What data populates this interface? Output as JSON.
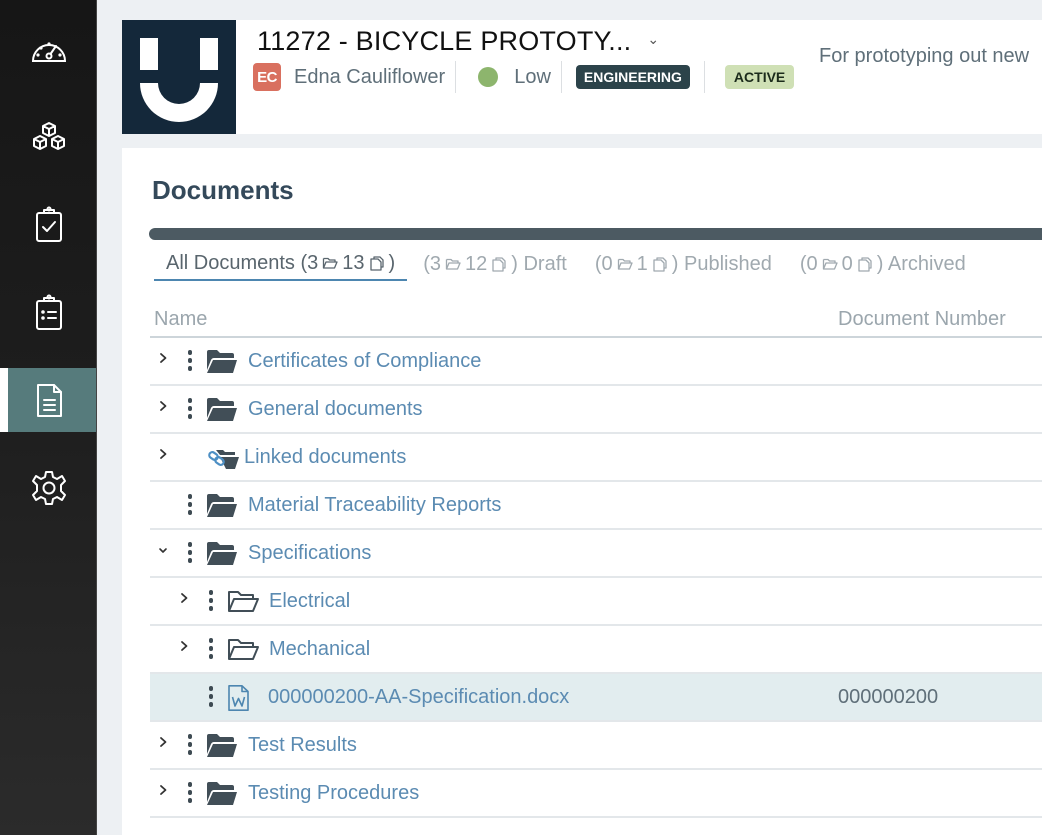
{
  "sidebar": {
    "items": [
      {
        "name": "dashboard",
        "icon": "gauge-icon",
        "active": false
      },
      {
        "name": "inventory",
        "icon": "cubes-icon",
        "active": false
      },
      {
        "name": "tasks",
        "icon": "clipboard-check-icon",
        "active": false
      },
      {
        "name": "lists",
        "icon": "clipboard-list-icon",
        "active": false
      },
      {
        "name": "documents",
        "icon": "document-icon",
        "active": true
      },
      {
        "name": "settings",
        "icon": "gear-icon",
        "active": false
      }
    ]
  },
  "header": {
    "title": "11272 - BICYCLE PROTOTY...",
    "owner_initials": "EC",
    "owner_name": "Edna Cauliflower",
    "priority": "Low",
    "department_badge": "ENGINEERING",
    "status_badge": "ACTIVE",
    "description": "For prototyping out new",
    "colors": {
      "logo_bg": "#14283a",
      "avatar": "#d9705f",
      "priority_dot": "#8db56d",
      "engineering_badge": "#2c434a",
      "active_badge": "#cfe0b5"
    }
  },
  "documents": {
    "title": "Documents",
    "tabs": [
      {
        "prefix": "All Documents (",
        "folders": "3",
        "files": "13",
        "suffix": ")",
        "label_after": "",
        "active": true
      },
      {
        "prefix": "(",
        "folders": "3",
        "files": "12",
        "suffix": ")",
        "label_after": " Draft",
        "active": false
      },
      {
        "prefix": "(",
        "folders": "0",
        "files": "1",
        "suffix": ")",
        "label_after": " Published",
        "active": false
      },
      {
        "prefix": "(",
        "folders": "0",
        "files": "0",
        "suffix": ")",
        "label_after": " Archived",
        "active": false
      }
    ],
    "columns": {
      "name": "Name",
      "document_number": "Document Number"
    },
    "rows": [
      {
        "name": "Certificates of Compliance",
        "type": "folder",
        "level": 0,
        "expander": "collapsed",
        "menu": true,
        "doc_number": ""
      },
      {
        "name": "General documents",
        "type": "folder",
        "level": 0,
        "expander": "collapsed",
        "menu": true,
        "doc_number": ""
      },
      {
        "name": "Linked documents",
        "type": "linked-folder",
        "level": 0,
        "expander": "collapsed",
        "menu": false,
        "doc_number": ""
      },
      {
        "name": "Material Traceability Reports",
        "type": "folder",
        "level": 0,
        "expander": "none",
        "menu": true,
        "doc_number": ""
      },
      {
        "name": "Specifications",
        "type": "folder",
        "level": 0,
        "expander": "expanded",
        "menu": true,
        "doc_number": ""
      },
      {
        "name": "Electrical",
        "type": "folder-outline",
        "level": 1,
        "expander": "collapsed",
        "menu": true,
        "doc_number": ""
      },
      {
        "name": "Mechanical",
        "type": "folder-outline",
        "level": 1,
        "expander": "collapsed",
        "menu": true,
        "doc_number": ""
      },
      {
        "name": "000000200-AA-Specification.docx",
        "type": "word-file",
        "level": 1,
        "expander": "none",
        "menu": true,
        "doc_number": "000000200",
        "selected": true
      },
      {
        "name": "Test Results",
        "type": "folder",
        "level": 0,
        "expander": "collapsed",
        "menu": true,
        "doc_number": ""
      },
      {
        "name": "Testing Procedures",
        "type": "folder",
        "level": 0,
        "expander": "collapsed",
        "menu": true,
        "doc_number": ""
      }
    ]
  }
}
